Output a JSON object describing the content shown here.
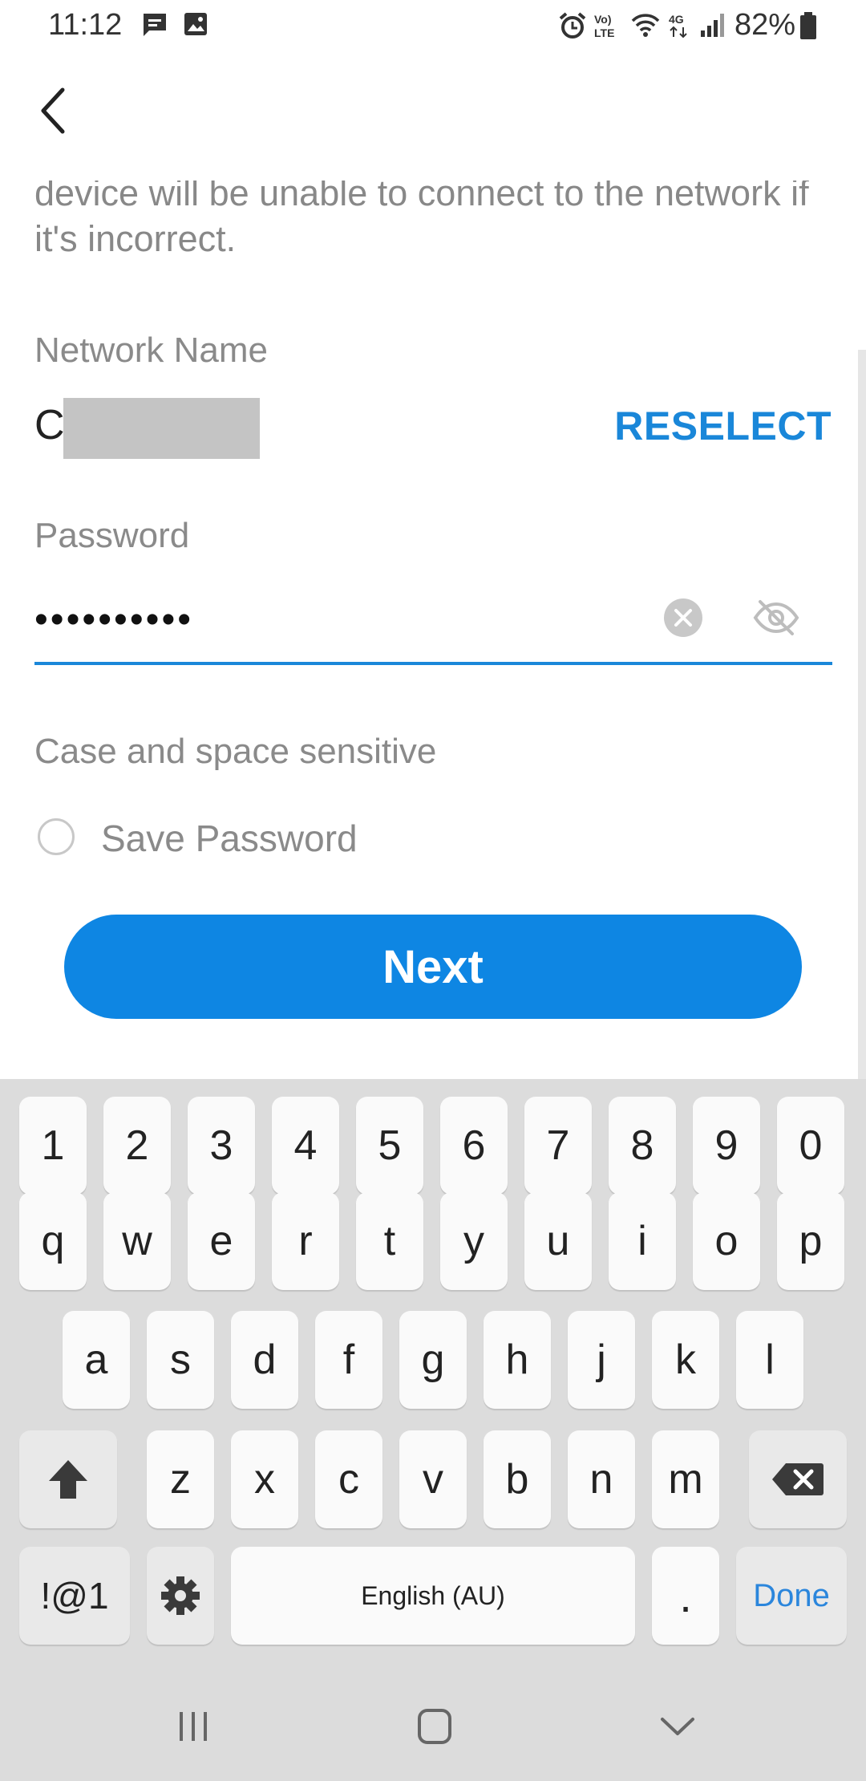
{
  "status_bar": {
    "time": "11:12",
    "battery_percent": "82%",
    "icons": [
      "chat-icon",
      "image-icon",
      "alarm-icon",
      "volte-icon",
      "wifi-icon",
      "4g-icon",
      "signal-icon",
      "battery-icon"
    ]
  },
  "header": {
    "back_icon": "chevron-left-icon"
  },
  "intro": {
    "text": "device will be unable to connect to the network if it's incorrect."
  },
  "network": {
    "label": "Network Name",
    "value_visible": "C",
    "reselect_label": "RESELECT"
  },
  "password": {
    "label": "Password",
    "value_masked": "••••••••••",
    "clear_icon": "clear-circle-icon",
    "visibility_icon": "eye-slash-icon",
    "hint": "Case and space sensitive"
  },
  "save_password": {
    "label": "Save Password",
    "checked": false
  },
  "next_button": {
    "label": "Next"
  },
  "colors": {
    "accent": "#1a87d9",
    "button": "#0e86e3",
    "hint_text": "#8a8a8a",
    "keyboard_bg": "#dcdcdc"
  },
  "keyboard": {
    "row_numbers": [
      "1",
      "2",
      "3",
      "4",
      "5",
      "6",
      "7",
      "8",
      "9",
      "0"
    ],
    "row_top": [
      "q",
      "w",
      "e",
      "r",
      "t",
      "y",
      "u",
      "i",
      "o",
      "p"
    ],
    "row_middle": [
      "a",
      "s",
      "d",
      "f",
      "g",
      "h",
      "j",
      "k",
      "l"
    ],
    "row_bottom": [
      "z",
      "x",
      "c",
      "v",
      "b",
      "n",
      "m"
    ],
    "symbols_label": "!@1",
    "space_label": "English (AU)",
    "period_label": ".",
    "done_label": "Done",
    "shift_icon": "shift-arrow-icon",
    "backspace_icon": "backspace-icon",
    "settings_icon": "gear-icon"
  },
  "nav_bar": {
    "icons": [
      "recent-apps-icon",
      "home-icon",
      "back-down-chevron-icon"
    ]
  }
}
